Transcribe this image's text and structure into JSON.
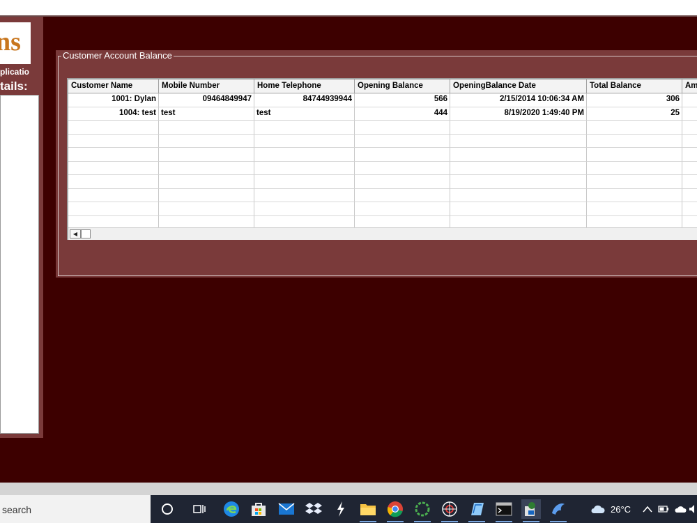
{
  "sidebar": {
    "logo_text": "ns",
    "app_label": "plicatio",
    "details_label": "tails:"
  },
  "group": {
    "title": "Customer Account Balance"
  },
  "grid": {
    "columns": [
      "Customer Name",
      "Mobile Number",
      "Home Telephone",
      "Opening Balance",
      "OpeningBalance Date",
      "Total Balance",
      "Am"
    ],
    "rows": [
      [
        "1001: Dylan",
        "09464849947",
        "84744939944",
        "566",
        "2/15/2014 10:06:34 AM",
        "306",
        ""
      ],
      [
        "1004: test",
        "test",
        "test",
        "444",
        "8/19/2020 1:49:40 PM",
        "25",
        ""
      ]
    ]
  },
  "taskbar": {
    "search_label": "search",
    "weather_temp": "26°C"
  },
  "colors": {
    "app_bg": "#3d0000",
    "panel_bg": "#7a3a3a",
    "logo_accent": "#c8761e"
  }
}
